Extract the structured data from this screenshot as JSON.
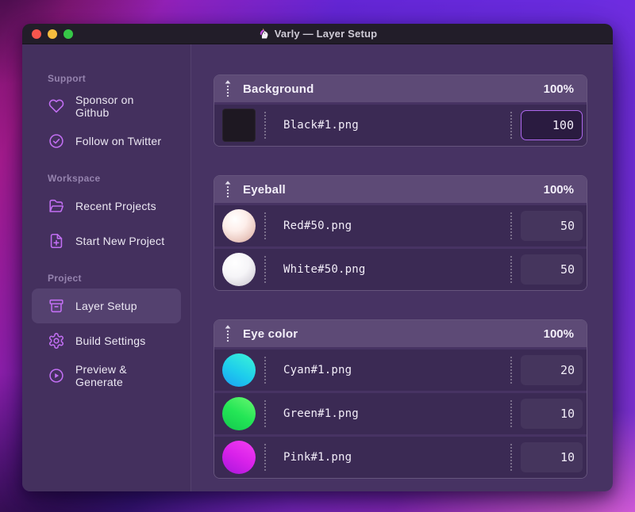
{
  "window": {
    "title": "Varly — Layer Setup",
    "app_icon": "unicorn-icon",
    "traffic_lights": [
      "close",
      "minimize",
      "zoom"
    ]
  },
  "sidebar": {
    "sections": [
      {
        "label": "Support",
        "items": [
          {
            "label": "Sponsor on Github",
            "icon": "heart-icon",
            "active": false
          },
          {
            "label": "Follow on Twitter",
            "icon": "verified-check-icon",
            "active": false
          }
        ]
      },
      {
        "label": "Workspace",
        "items": [
          {
            "label": "Recent Projects",
            "icon": "folder-open-icon",
            "active": false
          },
          {
            "label": "Start New Project",
            "icon": "file-plus-icon",
            "active": false
          }
        ]
      },
      {
        "label": "Project",
        "items": [
          {
            "label": "Layer Setup",
            "icon": "archive-box-icon",
            "active": true
          },
          {
            "label": "Build Settings",
            "icon": "gear-icon",
            "active": false
          },
          {
            "label": "Preview & Generate",
            "icon": "play-circle-icon",
            "active": false
          }
        ]
      }
    ]
  },
  "main": {
    "groups": [
      {
        "name": "Background",
        "weight": "100%",
        "rows": [
          {
            "file": "Black#1.png",
            "value": "100",
            "thumb": "black-square",
            "focused": true
          }
        ]
      },
      {
        "name": "Eyeball",
        "weight": "100%",
        "rows": [
          {
            "file": "Red#50.png",
            "value": "50",
            "thumb": "red-sphere",
            "focused": false
          },
          {
            "file": "White#50.png",
            "value": "50",
            "thumb": "white-sphere",
            "focused": false
          }
        ]
      },
      {
        "name": "Eye color",
        "weight": "100%",
        "rows": [
          {
            "file": "Cyan#1.png",
            "value": "20",
            "thumb": "cyan-circle",
            "focused": false
          },
          {
            "file": "Green#1.png",
            "value": "10",
            "thumb": "green-circle",
            "focused": false
          },
          {
            "file": "Pink#1.png",
            "value": "10",
            "thumb": "pink-circle",
            "focused": false
          }
        ]
      }
    ]
  },
  "colors": {
    "accent": "#ad67ec",
    "sidebar_icon": "#c16ef2",
    "close": "#f5554d",
    "minimize": "#f5bc3e",
    "zoom": "#36c747"
  }
}
